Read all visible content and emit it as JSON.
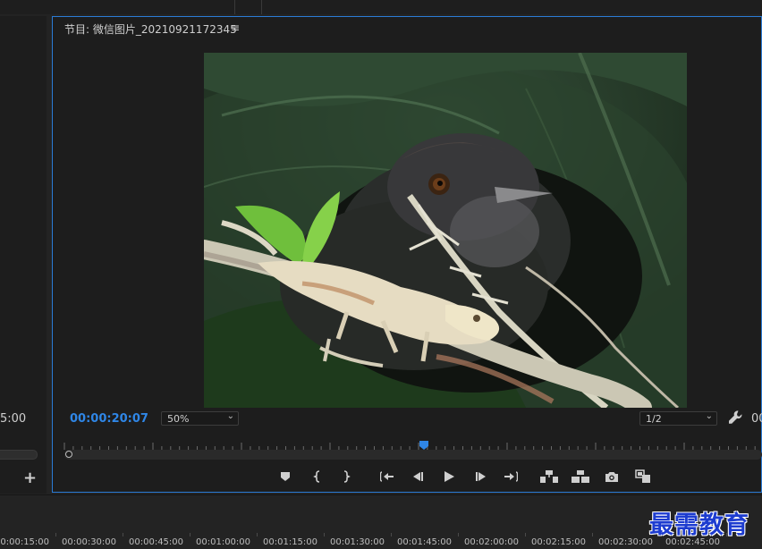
{
  "left_panel": {
    "timecode": "5:00",
    "add_label": "+"
  },
  "program_monitor": {
    "title": "节目: 微信图片_20210921172345",
    "menu_glyph": "≡",
    "timecode": "00:00:20:07",
    "zoom": "50%",
    "resolution": "1/2",
    "cut_text": "00",
    "controls": [
      "add-marker",
      "mark-in",
      "mark-out",
      "go-to-in",
      "step-back",
      "play",
      "step-forward",
      "go-to-out",
      "lift",
      "extract",
      "export-frame",
      "compare-view"
    ]
  },
  "timeline": {
    "labels": [
      "00:00:15:00",
      "00:00:30:00",
      "00:00:45:00",
      "00:01:00:00",
      "00:01:15:00",
      "00:01:30:00",
      "00:01:45:00",
      "00:02:00:00",
      "00:02:15:00",
      "00:02:30:00",
      "00:02:45:00"
    ]
  },
  "watermark": "最需教育",
  "colors": {
    "accent": "#2f86e6",
    "panel_border": "#2b7bd6",
    "watermark": "#1d3cd0"
  }
}
